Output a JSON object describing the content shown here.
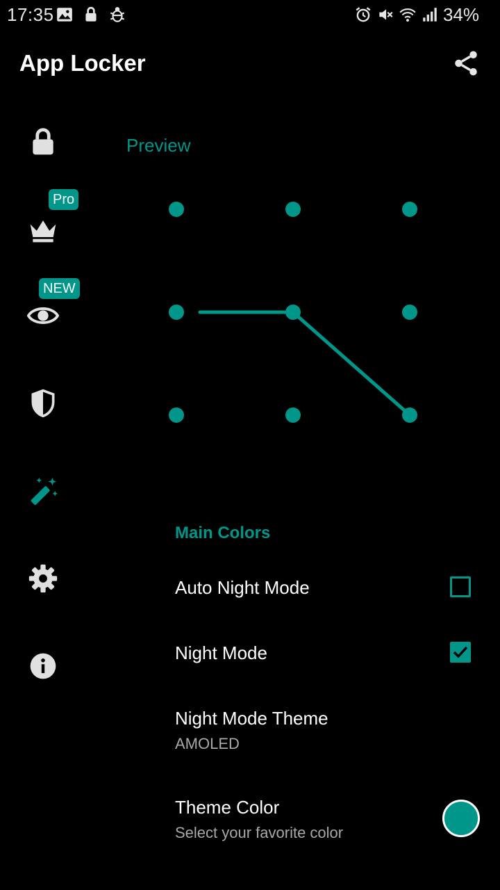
{
  "status_bar": {
    "time": "17:35",
    "battery": "34%"
  },
  "toolbar": {
    "title": "App Locker",
    "share_icon": "share-icon"
  },
  "sidebar": {
    "items": [
      {
        "name": "lock",
        "icon": "lock-icon"
      },
      {
        "name": "pro",
        "icon": "crown-icon",
        "badge": "Pro"
      },
      {
        "name": "appearance",
        "icon": "eye-icon",
        "badge": "NEW"
      },
      {
        "name": "security",
        "icon": "shield-icon"
      },
      {
        "name": "themes",
        "icon": "magic-wand-icon",
        "selected": true
      },
      {
        "name": "settings",
        "icon": "gear-icon"
      },
      {
        "name": "info",
        "icon": "info-icon"
      }
    ]
  },
  "preview": {
    "label": "Preview",
    "pattern_path": [
      3,
      4,
      8
    ]
  },
  "settings": {
    "section_header": "Main Colors",
    "auto_night_mode": {
      "title": "Auto Night Mode",
      "checked": false
    },
    "night_mode": {
      "title": "Night Mode",
      "checked": true
    },
    "night_mode_theme": {
      "title": "Night Mode Theme",
      "value": "AMOLED"
    },
    "theme_color": {
      "title": "Theme Color",
      "subtitle": "Select your favorite color"
    }
  },
  "colors": {
    "accent": "#00968a",
    "background": "#000000",
    "icon_gray": "#e0e0e0"
  }
}
